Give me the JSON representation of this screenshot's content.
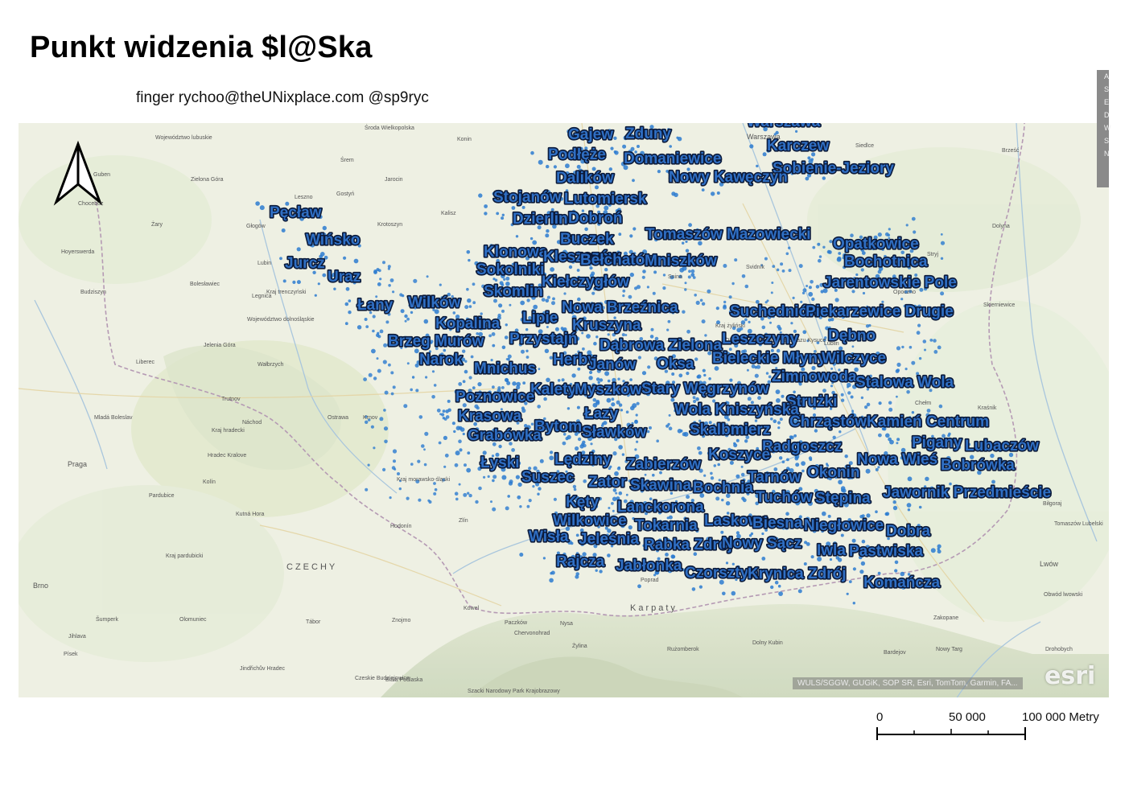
{
  "title": "Punkt widzenia $l@Ska",
  "subtitle": "finger rychoo@theUNixplace.com @sp9ryc",
  "map": {
    "attribution": "WULS/SGGW, GUGiK, SOP SR, Esri, TomTom, Garmin, FA...",
    "logo_text": "esri",
    "colors": {
      "label_fill": "#2f6fc4",
      "label_outline": "#0b1a3a",
      "point": "#2b7bd0",
      "basemap": "#eef0e3"
    },
    "side_tab_letters": [
      "A",
      "S",
      "E",
      "D",
      "W",
      "S",
      "N"
    ],
    "basemap_labels": [
      "Województwo lubuskie",
      "Środa Wielkopolska",
      "Konin",
      "Warszawa",
      "Siedlce",
      "Brześć",
      "Śrem",
      "Jarocin",
      "Guben",
      "Zielona Góra",
      "Gostyń",
      "Kalisz",
      "Leszno",
      "Żary",
      "Głogów",
      "Krotoszyn",
      "Chocebuz",
      "Lubin",
      "Hoyerswerda",
      "Bolesławiec",
      "Budziszyn",
      "Legnica",
      "Województwo dolnośląskie",
      "Jelenia Góra",
      "Wałbrzych",
      "Liberec",
      "Trutnov",
      "Náchod",
      "Mladá Boleslav",
      "Kraj hradecki",
      "Hradec Kralove",
      "Praga",
      "Kolín",
      "Pardubice",
      "Kutná Hora",
      "Kraj pardubicki",
      "CZECHY",
      "Šumperk",
      "Olomuniec",
      "Brno",
      "Tábor",
      "Jihlava",
      "Písek",
      "Jindřichův Hradec",
      "Czeskie Budziejowice",
      "Znojmo",
      "Hodonín",
      "Zlín",
      "Kraj morawsko-śląski",
      "Ostrawa",
      "Krnov",
      "Paczków",
      "Nysa",
      "Żylina",
      "Dolny Kubin",
      "Rużomberok",
      "Karpaty",
      "Poprad",
      "Zakopane",
      "Nowy Targ",
      "Bardejov",
      "Svidník",
      "Snina",
      "Radom",
      "Opoczno",
      "Skierniewice",
      "Lublin",
      "Chełm",
      "Kraśnik",
      "Biłgoraj",
      "Tomaszów Lubelski",
      "Lwów",
      "Obwód lwowski",
      "Drohobych",
      "Stryj",
      "Dolyna",
      "Chervonohrad",
      "Kowel",
      "Biała Podlaska",
      "Szacki Narodowy Park Krajobrazowy",
      "Kraj żyliński",
      "Obszar Chronionego Krajobrazu Kysuce",
      "Kraj trenczyński",
      "Prievidza",
      "Starachowice",
      "Kielce",
      "Legnica"
    ],
    "place_labels": [
      "Gajew",
      "Zduny",
      "Warszawa",
      "Karczew",
      "Podłęże",
      "Domaniewice",
      "Sobienie-Jeziory",
      "Dalików",
      "Nowy Kawęczyn",
      "Stojanów",
      "Lutomiersk",
      "Pęcław",
      "Dzierlin",
      "Dobroń",
      "Wińsko",
      "Buczek",
      "Tomaszów Mazowiecki",
      "Opatkowice",
      "Jurcz",
      "Klonowa",
      "Kleszczów",
      "Bełchatów",
      "Mniszków",
      "Bochotnica",
      "Uraz",
      "Sokolniki",
      "Kiełczygłów",
      "Jarentowskie Pole",
      "Skomlin",
      "Łany",
      "Wilków",
      "Nowa Brzeźnica",
      "Suchedniów",
      "Piekarzewice Drugie",
      "Kopalina",
      "Lipie",
      "Kruszyna",
      "Dębno",
      "Brzeg Murów",
      "Przystajń",
      "Leszczyny",
      "Dąbrowa Zielona",
      "Narok",
      "Herby",
      "Bieleckie Młyny",
      "Wilczyce",
      "Mnichus",
      "Janów",
      "Oksa",
      "Zimnowoda",
      "Stalowa Wola",
      "Kalety",
      "Myszków",
      "Stary Węgrzynów",
      "Poznowice",
      "Strużki",
      "Wola Kniszyńska",
      "Łazy",
      "Krasowa",
      "Chrząstów",
      "Kamień Centrum",
      "Bytom",
      "Sławków",
      "Skalbmierz",
      "Grabówka",
      "Radgoszcz",
      "Koszyce",
      "Pigany",
      "Lubaczów",
      "Lędziny",
      "Łyski",
      "Zabierzów",
      "Nowa Wieś",
      "Bobrówka",
      "Suszec",
      "Tarnów",
      "Okonin",
      "Zator",
      "Skawina",
      "Bochnia",
      "Tuchów",
      "Stępina",
      "Jawornik Przedmieście",
      "Kęty",
      "Lanckorona",
      "Wilkowice",
      "Laskowa",
      "Biesna",
      "Tokarnia",
      "Niegłowice",
      "Dobra",
      "Wisła",
      "Jeleśnia",
      "Rabka Zdrój",
      "Nowy Sącz",
      "Iwla",
      "Pastwiska",
      "Rajcza",
      "Jabłonka",
      "Czorsztyn",
      "Krynica Zdrój",
      "Komańcza"
    ]
  },
  "scalebar": {
    "labels": [
      "0",
      "50 000",
      "100 000 Metry"
    ]
  }
}
